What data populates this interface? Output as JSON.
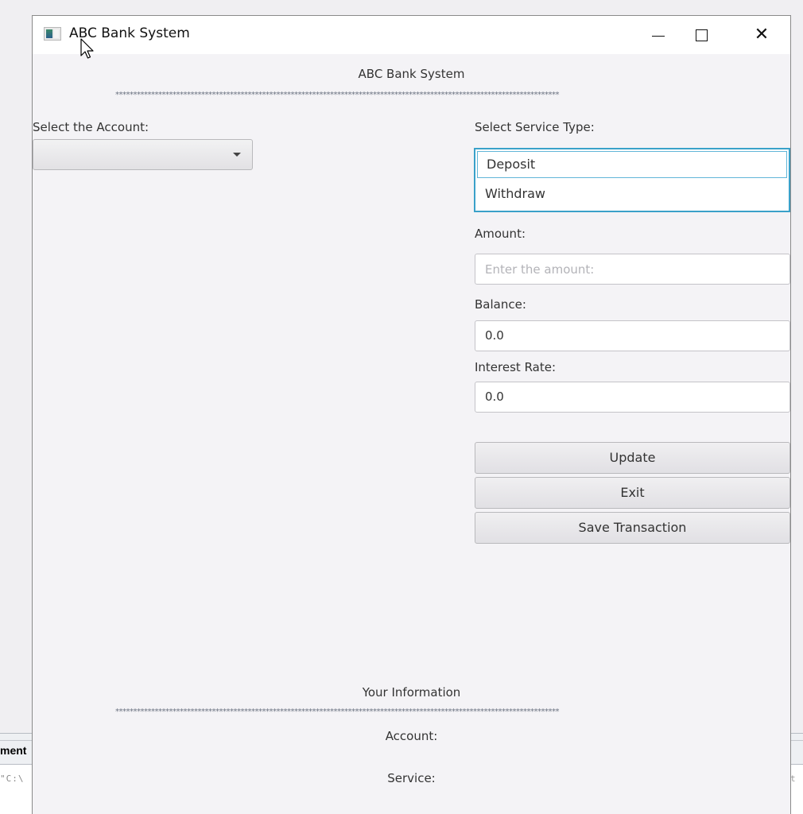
{
  "background": {
    "panel_label_fragment": "ment",
    "code_fragment_left": "\"C:\\",
    "code_fragment_right": "t"
  },
  "window": {
    "title": "ABC Bank System",
    "icon": "java-app-icon",
    "controls": {
      "minimize": "minimize-icon",
      "maximize": "maximize-icon",
      "close": "close-icon"
    }
  },
  "header": {
    "title": "ABC Bank System",
    "separator": "****************************************************************************************************************************"
  },
  "account": {
    "label": "Select the Account:",
    "selected": ""
  },
  "service": {
    "label": "Select Service Type:",
    "options": [
      "Deposit",
      "Withdraw"
    ],
    "selected": "Deposit"
  },
  "amount": {
    "label": "Amount:",
    "value": "",
    "placeholder": "Enter the amount:"
  },
  "balance": {
    "label": "Balance:",
    "value": "0.0"
  },
  "interest_rate": {
    "label": "Interest Rate:",
    "value": "0.0"
  },
  "buttons": {
    "update": "Update",
    "exit": "Exit",
    "save_transaction": "Save Transaction"
  },
  "info": {
    "title": "Your Information",
    "separator": "****************************************************************************************************************************",
    "account_label": "Account:",
    "service_label": "Service:"
  },
  "colors": {
    "focus_accent": "#3aa1c9",
    "window_bg": "#f4f3f6",
    "titlebar_bg": "#ffffff"
  }
}
